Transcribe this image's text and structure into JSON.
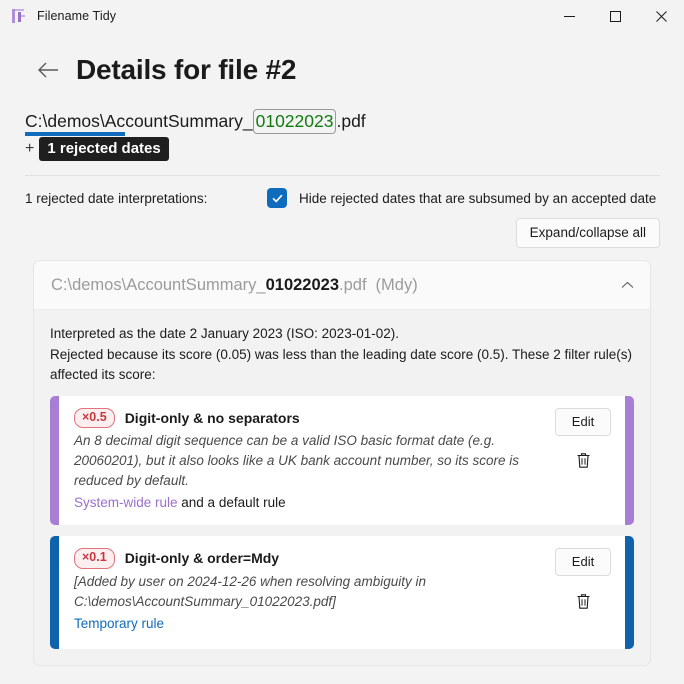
{
  "window": {
    "title": "Filename Tidy",
    "icon": "app-logo-icon",
    "controls": {
      "minimize": "minimize-icon",
      "maximize": "maximize-icon",
      "close": "close-icon"
    }
  },
  "header": {
    "back_icon": "back-arrow-icon",
    "title": "Details for file #2"
  },
  "filename": {
    "prefix_underlined": "C:\\demos\\Ac",
    "middle": "countSummary_",
    "date_token": "01022023",
    "suffix": ".pdf",
    "plus": "+",
    "rejected_badge": "1 rejected dates"
  },
  "options": {
    "count_label": "1 rejected date interpretations:",
    "hide_checkbox_label": "Hide rejected dates that are subsumed by an accepted date",
    "hide_checkbox_checked": true,
    "expand_collapse_button": "Expand/collapse all"
  },
  "expander": {
    "path_prefix": "C:\\demos\\AccountSummary_",
    "path_date": "01022023",
    "path_suffix": ".pdf",
    "order_tag": "(Mdy)",
    "chevron": "chevron-up-icon",
    "explanation_line_1": "Interpreted as the date 2 January 2023 (ISO: 2023-01-02).",
    "explanation_line_2": "Rejected because its score (0.05) was less than the leading date score (0.5). These 2 filter rule(s) affected its score:"
  },
  "rules": [
    {
      "multiplier": "×0.5",
      "title": "Digit-only & no separators",
      "description": "An 8 decimal digit sequence can be a valid ISO basic format date (e.g. 20060201), but it also looks like a UK bank account number, so its score is reduced by default.",
      "link_text": "System-wide rule",
      "link_suffix": " and a default rule",
      "link_color": "#9b6fce",
      "rail_color": "#a87dd4",
      "edit_label": "Edit",
      "delete_icon": "trash-icon"
    },
    {
      "multiplier": "×0.1",
      "title": "Digit-only & order=Mdy",
      "description": "[Added by user on 2024-12-26 when resolving ambiguity in C:\\demos\\AccountSummary_01022023.pdf]",
      "link_text": "Temporary rule",
      "link_suffix": "",
      "link_color": "#0f6cbd",
      "rail_color": "#0f62ac",
      "edit_label": "Edit",
      "delete_icon": "trash-icon"
    }
  ],
  "colors": {
    "accent_blue": "#0f6cbd",
    "date_green": "#107c10",
    "badge_red_text": "#c8373f",
    "badge_red_border": "#e0747a",
    "purple": "#9b6fce",
    "page_bg": "#f3f3f3"
  }
}
